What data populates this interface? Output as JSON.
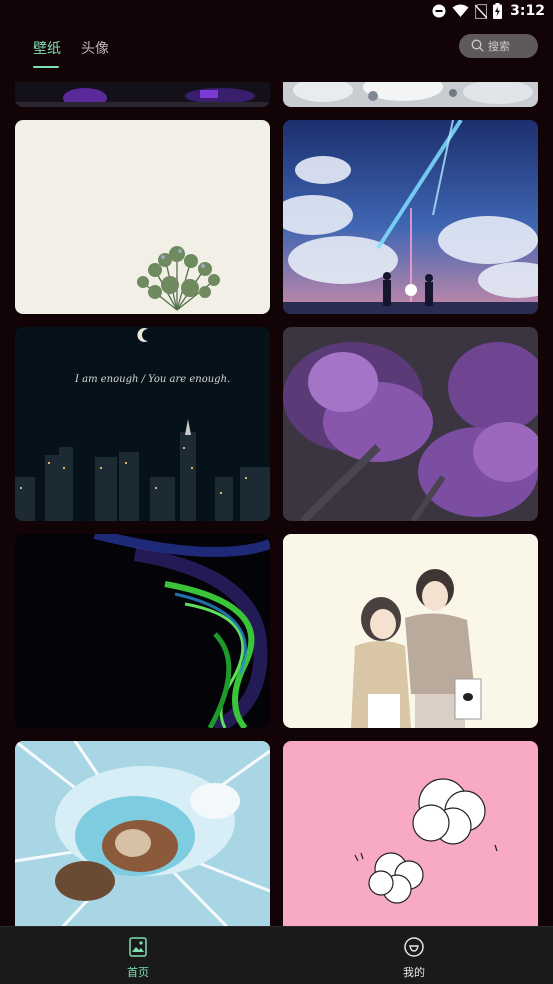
{
  "status_bar": {
    "time": "3:12",
    "icons": [
      "do-not-disturb-icon",
      "wifi-icon",
      "no-sim-icon",
      "battery-charging-icon"
    ]
  },
  "header": {
    "tabs": [
      {
        "label": "壁纸",
        "active": true
      },
      {
        "label": "头像",
        "active": false
      }
    ],
    "search": {
      "placeholder": "搜索"
    },
    "accent_color": "#7fe0b4"
  },
  "wallpapers": [
    {
      "subject": "purple-night-partial"
    },
    {
      "subject": "white-blossom-partial"
    },
    {
      "subject": "plant-on-cream-background"
    },
    {
      "subject": "anime-comet-sky-couple"
    },
    {
      "subject": "night-city-skyline-moon",
      "caption": "I am enough / You are enough."
    },
    {
      "subject": "purple-tulips"
    },
    {
      "subject": "green-neon-waves"
    },
    {
      "subject": "cartoon-couple"
    },
    {
      "subject": "blue-color-explosion"
    },
    {
      "subject": "pink-cotton-clouds"
    }
  ],
  "bottom_nav": {
    "items": [
      {
        "label": "首页",
        "icon": "home-image-icon",
        "active": true
      },
      {
        "label": "我的",
        "icon": "profile-icon",
        "active": false
      }
    ]
  }
}
